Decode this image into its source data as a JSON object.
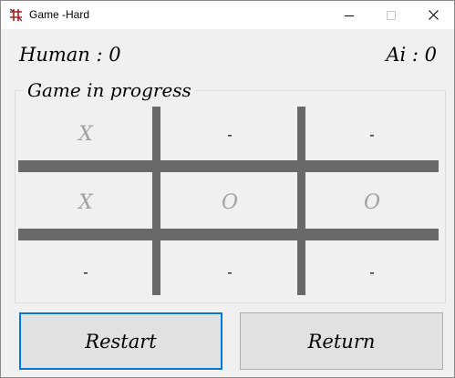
{
  "window": {
    "title": "Game -Hard",
    "icon": "grid-app-icon",
    "controls": [
      "minimize-icon",
      "maximize-icon",
      "close-icon"
    ]
  },
  "scores": {
    "human_label": "Human : 0",
    "ai_label": "Ai : 0"
  },
  "status": {
    "label": "Game in progress"
  },
  "board": {
    "cells": [
      [
        "X",
        "-",
        "-"
      ],
      [
        "X",
        "O",
        "O"
      ],
      [
        "-",
        "-",
        "-"
      ]
    ],
    "mark_color": "#a0a0a0",
    "line_color": "#696969"
  },
  "buttons": {
    "restart_label": "Restart",
    "return_label": "Return",
    "focus_color": "#0078d7"
  }
}
